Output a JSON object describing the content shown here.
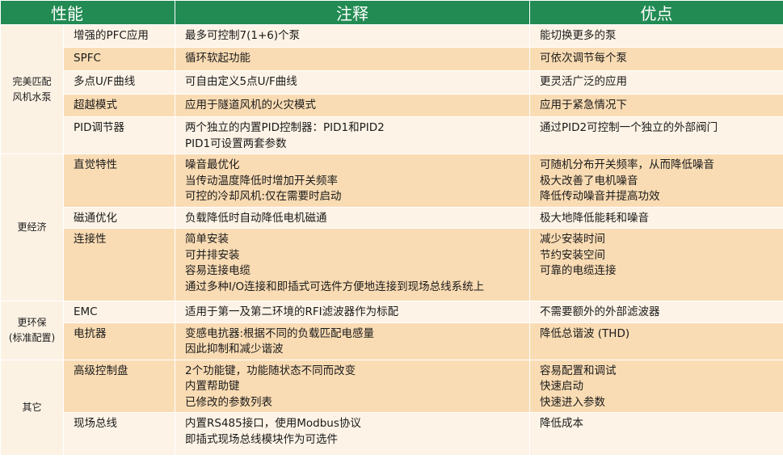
{
  "header": {
    "col1": "性能",
    "col2": "注释",
    "col3": "优点"
  },
  "groups": [
    {
      "category": [
        "完美匹配",
        "风机水泵"
      ],
      "rows": [
        {
          "feature": "增强的PFC应用",
          "notes": [
            "最多可控制7(1+6)个泵"
          ],
          "benefits": [
            "能切换更多的泵"
          ]
        },
        {
          "feature": "SPFC",
          "notes": [
            "循环软起功能"
          ],
          "benefits": [
            "可依次调节每个泵"
          ]
        },
        {
          "feature": "多点U/F曲线",
          "notes": [
            "可自由定义5点U/F曲线"
          ],
          "benefits": [
            "更灵活广泛的应用"
          ]
        },
        {
          "feature": "超越模式",
          "notes": [
            "应用于隧道风机的火灾模式"
          ],
          "benefits": [
            "应用于紧急情况下"
          ]
        },
        {
          "feature": "PID调节器",
          "notes": [
            "两个独立的内置PID控制器：PID1和PID2",
            "PID1可设置两套参数"
          ],
          "benefits": [
            "通过PID2可控制一个独立的外部阀门"
          ]
        }
      ]
    },
    {
      "category": [
        "更经济"
      ],
      "rows": [
        {
          "feature": "直觉特性",
          "notes": [
            "噪音最优化",
            "当传动温度降低时增加开关频率",
            "可控的冷却风机:仅在需要时启动"
          ],
          "benefits": [
            "可随机分布开关频率，从而降低噪音",
            "极大改善了电机噪音",
            "降低传动噪音并提高功效"
          ]
        },
        {
          "feature": "磁通优化",
          "notes": [
            "负载降低时自动降低电机磁通"
          ],
          "benefits": [
            "极大地降低能耗和噪音"
          ]
        },
        {
          "feature": "连接性",
          "notes": [
            "简单安装",
            "可并排安装",
            "容易连接电缆",
            "通过多种I/O连接和即插式可选件方便地连接到现场总线系统上"
          ],
          "benefits": [
            "减少安装时间",
            "节约安装空间",
            "可靠的电缆连接"
          ]
        }
      ]
    },
    {
      "category": [
        "更环保",
        "(标准配置)"
      ],
      "rows": [
        {
          "feature": "EMC",
          "notes": [
            "适用于第一及第二环境的RFI滤波器作为标配"
          ],
          "benefits": [
            "不需要额外的外部滤波器"
          ]
        },
        {
          "feature": "电抗器",
          "notes": [
            "变感电抗器:根据不同的负载匹配电感量",
            "因此抑制和减少谐波"
          ],
          "benefits": [
            "降低总谐波 (THD)"
          ]
        }
      ]
    },
    {
      "category": [
        "其它"
      ],
      "rows": [
        {
          "feature": "高级控制盘",
          "notes": [
            "2个功能键，功能随状态不同而改变",
            "内置帮助键",
            "已修改的参数列表"
          ],
          "benefits": [
            "容易配置和调试",
            "快速启动",
            "快速进入参数"
          ]
        },
        {
          "feature": "现场总线",
          "notes": [
            "内置RS485接口，使用Modbus协议",
            "即插式现场总线模块作为可选件"
          ],
          "benefits": [
            "降低成本"
          ]
        }
      ]
    }
  ],
  "colors": {
    "header_bg": "#228b53",
    "row_light": "#fdf3e6",
    "row_dark": "#fadcb4"
  }
}
